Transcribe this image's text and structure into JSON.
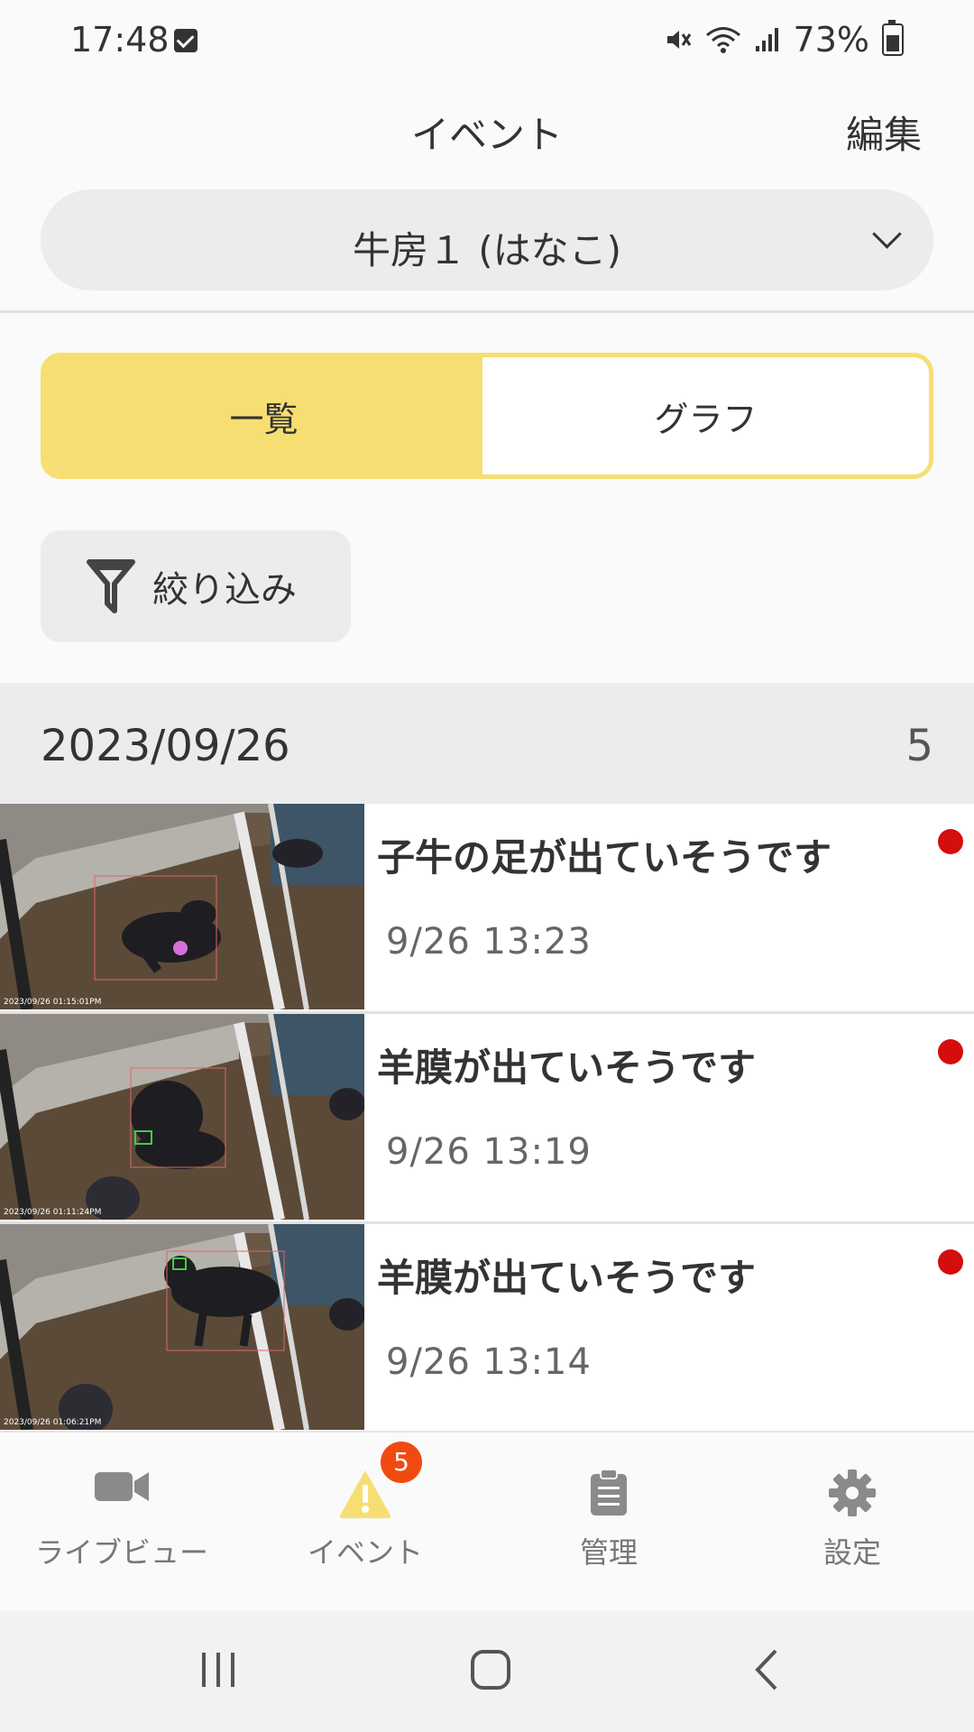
{
  "status_bar": {
    "time": "17:48",
    "battery": "73%"
  },
  "header": {
    "title": "イベント",
    "edit_label": "編集"
  },
  "barn_select": {
    "selected": "牛房１ (はなこ)"
  },
  "segment": {
    "list_label": "一覧",
    "graph_label": "グラフ",
    "selected": "一覧"
  },
  "filter": {
    "label": "絞り込み"
  },
  "date_group": {
    "date": "2023/09/26",
    "count": "5"
  },
  "events": [
    {
      "title": "子牛の足が出ていそうです",
      "time": "9/26  13:23",
      "thumb_stamp": "2023/09/26 01:15:01PM",
      "unread": true
    },
    {
      "title": "羊膜が出ていそうです",
      "time": "9/26  13:19",
      "thumb_stamp": "2023/09/26 01:11:24PM",
      "unread": true
    },
    {
      "title": "羊膜が出ていそうです",
      "time": "9/26  13:14",
      "thumb_stamp": "2023/09/26 01:06:21PM",
      "unread": true
    }
  ],
  "bottom_nav": {
    "items": [
      {
        "label": "ライブビュー",
        "icon": "video-camera-icon"
      },
      {
        "label": "イベント",
        "icon": "warning-icon",
        "badge": "5",
        "active": true
      },
      {
        "label": "管理",
        "icon": "clipboard-icon"
      },
      {
        "label": "設定",
        "icon": "gear-icon"
      }
    ]
  },
  "colors": {
    "accent_yellow": "#f7de72",
    "badge_orange": "#f04a12",
    "unread_red": "#d40d0d"
  }
}
